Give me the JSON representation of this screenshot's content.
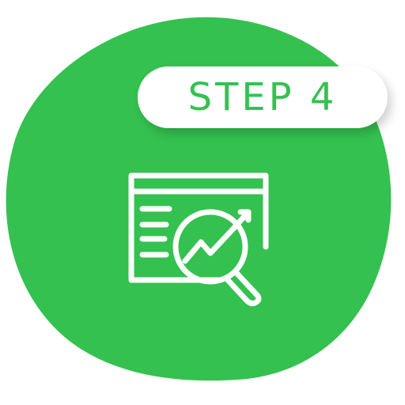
{
  "badge": {
    "label": "STEP 4"
  },
  "icon": {
    "name": "analytics-magnifier-icon"
  },
  "colors": {
    "blob": "#34c150",
    "badge_background": "#ffffff",
    "badge_text": "#34c150",
    "icon_stroke": "#ffffff"
  }
}
